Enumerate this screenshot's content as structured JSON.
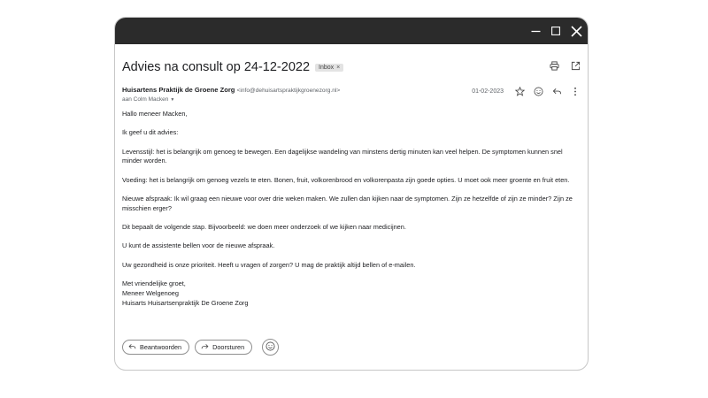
{
  "window": {
    "controls": [
      "minimize-icon",
      "maximize-icon",
      "close-icon"
    ]
  },
  "email": {
    "subject": "Advies na consult op 24-12-2022",
    "label": "Inbox",
    "label_remove": "×",
    "sender_name": "Huisartens Praktijk de Groene Zorg",
    "sender_email": "<info@dehuisartspraktijkgroenezorg.nl>",
    "recipient": "aan Colm Macken",
    "date": "01-02-2023",
    "header_icons": [
      "print-icon",
      "open-in-new-window-icon"
    ],
    "meta_icons": [
      "star-icon",
      "emoji-icon",
      "reply-icon",
      "more-vert-icon"
    ]
  },
  "body": {
    "greeting": "Hallo meneer Macken,",
    "intro": "Ik geef u dit advies:",
    "p1": "Levensstijl: het is belangrijk om genoeg te bewegen. Een dagelijkse wandeling van minstens dertig minuten kan veel helpen. De symptomen kunnen snel minder worden.",
    "p2": "Voeding: het is belangrijk om genoeg vezels te eten. Bonen, fruit, volkorenbrood en volkorenpasta zijn goede opties. U moet ook meer groente en fruit eten.",
    "p3": "Nieuwe afspraak: Ik wil graag een nieuwe voor over drie weken maken. We zullen dan kijken naar de symptomen. Zijn ze hetzelfde of zijn ze minder? Zijn ze misschien erger?",
    "p4": "Dit bepaalt de volgende stap. Bijvoorbeeld: we doen meer onderzoek of we kijken naar medicijnen.",
    "p5": "U kunt de assistente bellen voor de nieuwe afspraak.",
    "p6": "Uw gezondheid is onze prioriteit. Heeft u vragen of zorgen? U mag de praktijk altijd bellen of e-mailen.",
    "closing": "Met vriendelijke groet,",
    "signer": "Meneer Welgenoeg",
    "signer_title": "Huisarts Huisartsenpraktijk De Groene Zorg"
  },
  "actions": {
    "reply_label": "Beantwoorden",
    "forward_label": "Doorsturen",
    "emoji_icon": "emoji-icon"
  },
  "colors": {
    "titlebar": "#2b2b2b",
    "text": "#202124",
    "muted": "#5f6368",
    "label_bg": "#e3e3e3"
  }
}
